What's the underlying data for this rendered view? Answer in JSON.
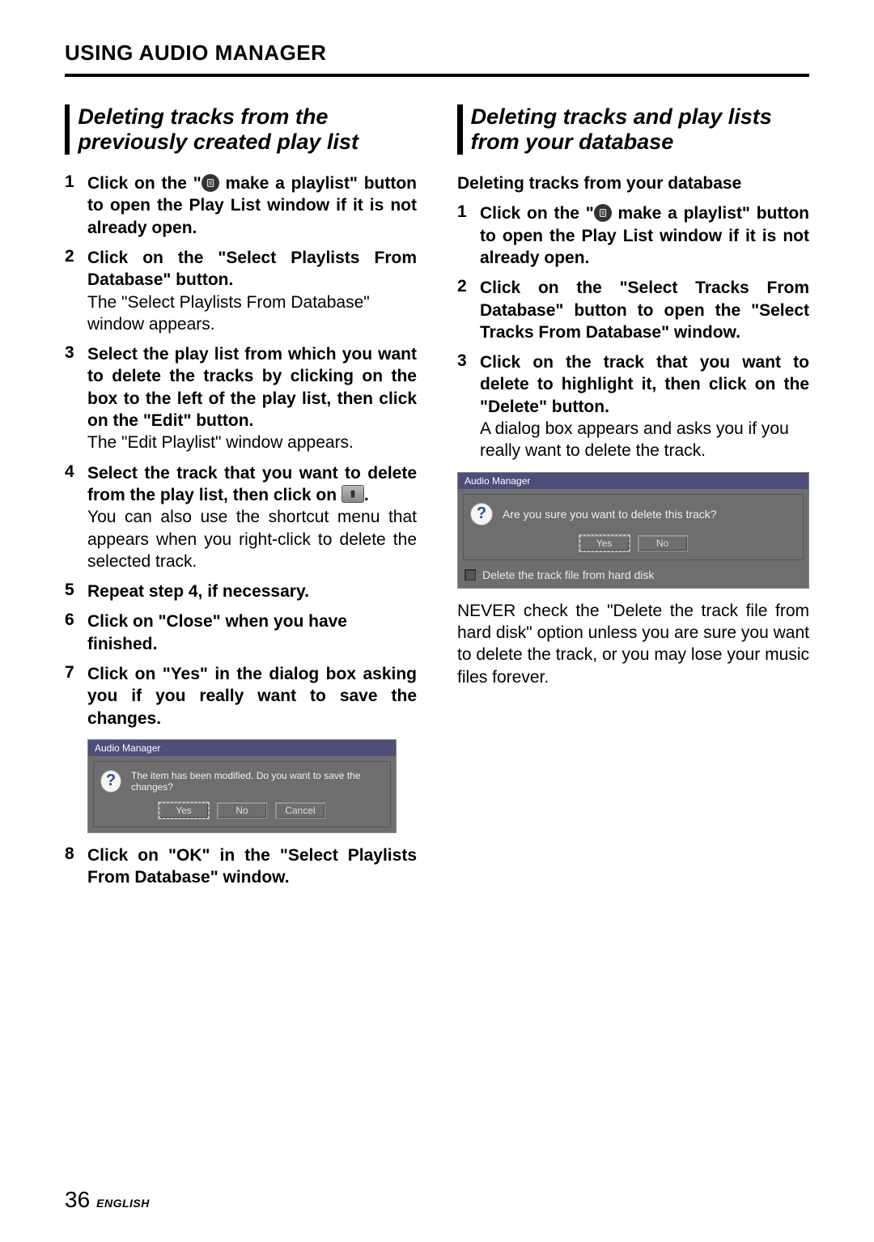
{
  "header": "USING AUDIO MANAGER",
  "left": {
    "title": "Deleting tracks from the previously created play list",
    "steps": {
      "s1a": "Click on the \"",
      "s1b": " make a playlist\" button to open the Play List window if it is not already open.",
      "s2_bold": "Click on the \"Select Playlists From Database\" button.",
      "s2_body": "The \"Select Playlists From Database\" window appears.",
      "s3_bold": "Select the play list from which you want to delete the tracks by clicking on the box to the left of the play list, then click on the \"Edit\" button.",
      "s3_body": "The \"Edit Playlist\" window appears.",
      "s4_bold_a": "Select the track that you want to delete from the play list, then click on ",
      "s4_bold_b": ".",
      "s4_body": "You can also use the shortcut menu that appears when you right-click to delete the selected track.",
      "s5_bold": "Repeat step 4, if necessary.",
      "s6_bold": "Click on \"Close\" when you have finished.",
      "s7_bold": "Click on \"Yes\" in the dialog box asking you if you really want to save the changes.",
      "s8_bold": "Click on \"OK\" in the \"Select Playlists From Database\" window."
    },
    "dialog": {
      "title": "Audio Manager",
      "message": "The item has been modified.  Do you want to save the changes?",
      "yes": "Yes",
      "no": "No",
      "cancel": "Cancel"
    }
  },
  "right": {
    "title": "Deleting tracks and play lists from your database",
    "subheading": "Deleting tracks from your database",
    "steps": {
      "s1a": "Click on the \"",
      "s1b": " make a playlist\" button to open the Play List window if it is not already open.",
      "s2_bold": "Click on the \"Select Tracks From Database\" button to open the \"Select Tracks From Database\" window.",
      "s3_bold": "Click on the track that you want to delete to highlight it, then click on the \"Delete\" button.",
      "s3_body": "A dialog box appears and asks you if you really want to delete the track."
    },
    "dialog": {
      "title": "Audio Manager",
      "message": "Are you sure you want to delete this track?",
      "yes": "Yes",
      "no": "No",
      "checkbox": "Delete the track file from hard disk"
    },
    "post": "NEVER check the \"Delete the track file from hard disk\" option unless you are sure you want to delete the track, or you may lose your music files forever."
  },
  "footer": {
    "page": "36",
    "language": "ENGLISH"
  }
}
